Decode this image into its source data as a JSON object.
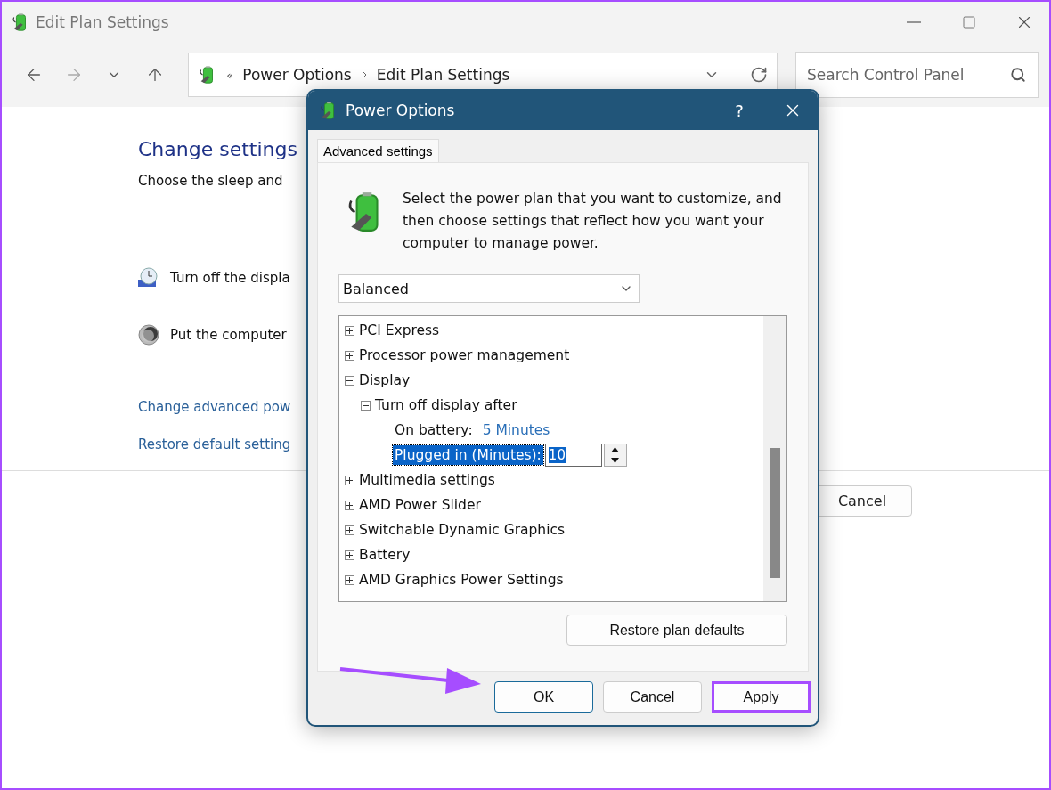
{
  "window": {
    "title": "Edit Plan Settings"
  },
  "address_bar": {
    "separator": "«",
    "breadcrumb": [
      "Power Options",
      "Edit Plan Settings"
    ]
  },
  "search": {
    "placeholder": "Search Control Panel"
  },
  "content": {
    "heading": "Change settings",
    "subtitle": "Choose the sleep and",
    "settings": [
      {
        "kind": "display",
        "label": "Turn off the displa"
      },
      {
        "kind": "sleep",
        "label": "Put the computer"
      }
    ],
    "links": [
      "Change advanced pow",
      "Restore default setting"
    ],
    "buttons": [
      "Cancel"
    ]
  },
  "dialog": {
    "title": "Power Options",
    "help": "?",
    "tabs": [
      {
        "label": "Advanced settings",
        "selected": true
      }
    ],
    "description": "Select the power plan that you want to customize, and then choose settings that reflect how you want your computer to manage power.",
    "plan": {
      "value": "Balanced"
    },
    "tree": [
      {
        "kind": "group",
        "label": "PCI Express",
        "expanded": false
      },
      {
        "kind": "group",
        "label": "Processor power management",
        "expanded": false
      },
      {
        "kind": "group",
        "label": "Display",
        "expanded": true,
        "children": [
          {
            "kind": "group",
            "label": "Turn off display after",
            "expanded": true,
            "children": [
              {
                "kind": "value",
                "label": "On battery:",
                "value": "5 Minutes",
                "selected": false
              },
              {
                "kind": "spin",
                "label": "Plugged in (Minutes):",
                "value": "10",
                "selected": true
              }
            ]
          }
        ]
      },
      {
        "kind": "group",
        "label": "Multimedia settings",
        "expanded": false
      },
      {
        "kind": "group",
        "label": "AMD Power Slider",
        "expanded": false
      },
      {
        "kind": "group",
        "label": "Switchable Dynamic Graphics",
        "expanded": false
      },
      {
        "kind": "group",
        "label": "Battery",
        "expanded": false
      },
      {
        "kind": "group",
        "label": "AMD Graphics Power Settings",
        "expanded": false
      }
    ],
    "restore_button": "Restore plan defaults",
    "buttons": [
      {
        "label": "OK",
        "kind": "default",
        "highlighted": false
      },
      {
        "label": "Cancel",
        "kind": "normal",
        "highlighted": false
      },
      {
        "label": "Apply",
        "kind": "normal",
        "highlighted": true
      }
    ]
  }
}
